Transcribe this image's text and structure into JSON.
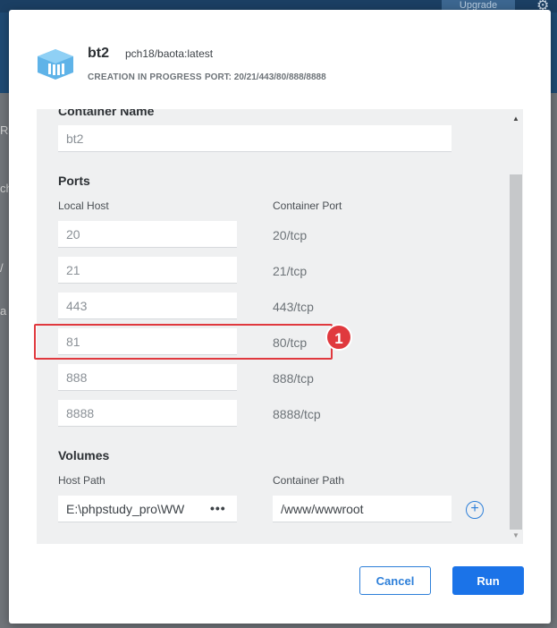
{
  "backdrop": {
    "upgrade_label": "Upgrade",
    "side_fragments": [
      "R",
      "ch",
      "/",
      "a"
    ]
  },
  "header": {
    "container_name": "bt2",
    "image": "pch18/baota:latest",
    "status": "CREATION IN PROGRESS",
    "port_info": "PORT: 20/21/443/80/888/8888",
    "icon": "container-stack-icon"
  },
  "form": {
    "container_name_label": "Container Name",
    "container_name_value": "bt2",
    "ports_title": "Ports",
    "local_host_label": "Local Host",
    "container_port_label": "Container Port",
    "ports": [
      {
        "local": "20",
        "container": "20/tcp"
      },
      {
        "local": "21",
        "container": "21/tcp"
      },
      {
        "local": "443",
        "container": "443/tcp"
      },
      {
        "local": "81",
        "container": "80/tcp"
      },
      {
        "local": "888",
        "container": "888/tcp"
      },
      {
        "local": "8888",
        "container": "8888/tcp"
      }
    ],
    "volumes_title": "Volumes",
    "host_path_label": "Host Path",
    "container_path_label": "Container Path",
    "host_path_value": "E:\\phpstudy_pro\\WW",
    "container_path_value": "/www/wwwroot",
    "browse_label": "•••",
    "add_label": "+"
  },
  "annotation": {
    "badge_number": "1",
    "color": "#e0393e"
  },
  "footer": {
    "cancel_label": "Cancel",
    "run_label": "Run"
  },
  "colors": {
    "accent": "#1b73e8",
    "outline_accent": "#2d7fd9"
  }
}
